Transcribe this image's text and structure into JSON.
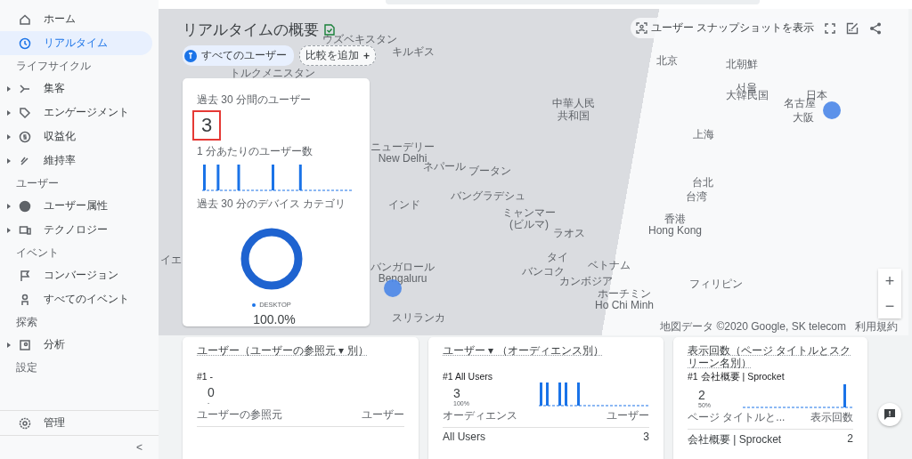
{
  "sidebar": {
    "items": [
      {
        "kind": "item",
        "label": "ホーム",
        "selected": false,
        "expandable": false
      },
      {
        "kind": "item",
        "label": "リアルタイム",
        "selected": true,
        "expandable": false
      },
      {
        "kind": "section",
        "label": "ライフサイクル"
      },
      {
        "kind": "item",
        "label": "集客",
        "selected": false,
        "expandable": true
      },
      {
        "kind": "item",
        "label": "エンゲージメント",
        "selected": false,
        "expandable": true
      },
      {
        "kind": "item",
        "label": "収益化",
        "selected": false,
        "expandable": true
      },
      {
        "kind": "item",
        "label": "維持率",
        "selected": false,
        "expandable": true
      },
      {
        "kind": "section",
        "label": "ユーザー"
      },
      {
        "kind": "item",
        "label": "ユーザー属性",
        "selected": false,
        "expandable": true
      },
      {
        "kind": "item",
        "label": "テクノロジー",
        "selected": false,
        "expandable": true
      },
      {
        "kind": "section",
        "label": "イベント"
      },
      {
        "kind": "item",
        "label": "コンバージョン",
        "selected": false,
        "expandable": false
      },
      {
        "kind": "item",
        "label": "すべてのイベント",
        "selected": false,
        "expandable": false
      },
      {
        "kind": "section",
        "label": "探索"
      },
      {
        "kind": "item",
        "label": "分析",
        "selected": false,
        "expandable": true
      },
      {
        "kind": "section",
        "label": "設定"
      }
    ],
    "footer_item": {
      "label": "管理"
    },
    "collapse": "<"
  },
  "page": {
    "title": "リアルタイムの概要",
    "segment": "すべてのユーザー",
    "compare": "比較を追加",
    "compare_icon": "+",
    "snapshot": "ユーザー スナップショットを表示"
  },
  "map": {
    "labels": [
      {
        "text": "ウズベキスタン"
      },
      {
        "text": "キルギス"
      },
      {
        "text": "トルクメニスタン"
      },
      {
        "text": "北京"
      },
      {
        "text": "北朝鮮"
      },
      {
        "text": "서울"
      },
      {
        "text": "大韓民国"
      },
      {
        "text": "日本"
      },
      {
        "text": "名古屋"
      },
      {
        "text": "大阪"
      },
      {
        "text": "中華人民"
      },
      {
        "text": "共和国"
      },
      {
        "text": "上海"
      },
      {
        "text": "ニューデリー\nNew Delhi"
      },
      {
        "text": "ネパール"
      },
      {
        "text": "ブータン"
      },
      {
        "text": "バングラデシュ"
      },
      {
        "text": "インド"
      },
      {
        "text": "ミャンマー\n(ビルマ)"
      },
      {
        "text": "台北"
      },
      {
        "text": "台湾"
      },
      {
        "text": "ラオス"
      },
      {
        "text": "香港\nHong Kong"
      },
      {
        "text": "タイ"
      },
      {
        "text": "バンコク"
      },
      {
        "text": "ベトナム"
      },
      {
        "text": "カンボジア"
      },
      {
        "text": "ホーチミン\nHo Chi Minh"
      },
      {
        "text": "フィリピン"
      },
      {
        "text": "バンガロール\nBengaluru"
      },
      {
        "text": "スリランカ"
      },
      {
        "text": "イエ"
      }
    ],
    "zoom_in": "+",
    "zoom_out": "−",
    "attribution": "地図データ ©2020 Google, SK telecom",
    "terms": "利用規約"
  },
  "overview": {
    "users_label": "過去 30 分間のユーザー",
    "users_value": "3",
    "highlighted": true,
    "per_minute_label": "1 分あたりのユーザー数",
    "device_label": "過去 30 分のデバイス カテゴリ",
    "legend": "DESKTOP",
    "share": "100.0%"
  },
  "cards": [
    {
      "title": "ユーザー（ユーザーの参照元 ▾ 別）",
      "rank": "#1 -",
      "value": "0",
      "share": "-",
      "spark": false,
      "col_1": "ユーザーの参照元",
      "col_2": "ユーザー"
    },
    {
      "title": "ユーザー ▾ （オーディエンス別）",
      "rank": "#1 All Users",
      "value": "3",
      "share": "100%",
      "spark": true,
      "col_1": "オーディエンス",
      "col_2": "ユーザー",
      "rows": [
        {
          "name": "All Users",
          "value": "3"
        }
      ]
    },
    {
      "title": "表示回数（ページ タイトルとスクリーン名別）",
      "rank": "#1 会社概要 | Sprocket",
      "value": "2",
      "share": "50%",
      "spark": true,
      "col_1": "ページ タイトルと...",
      "col_2": "表示回数",
      "rows": [
        {
          "name": "会社概要 | Sprocket",
          "value": "2"
        }
      ]
    }
  ]
}
